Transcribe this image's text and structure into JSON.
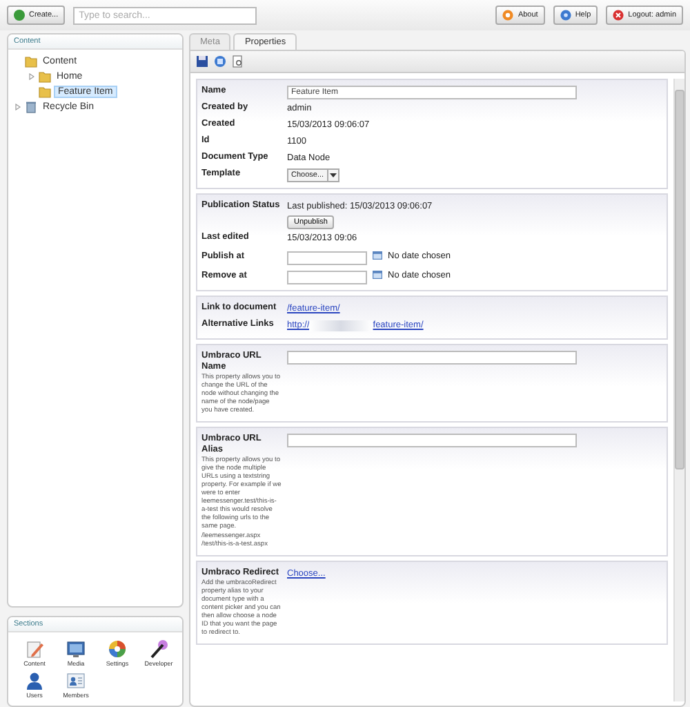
{
  "topbar": {
    "create_button": "Create...",
    "search": {
      "placeholder": "Type to search..."
    },
    "buttons": [
      {
        "kind": "about",
        "label": "About"
      },
      {
        "kind": "help",
        "label": "Help"
      },
      {
        "kind": "logout",
        "label": "Logout: admin"
      }
    ]
  },
  "tree": {
    "title": "Content",
    "items": [
      {
        "label": "Content",
        "kind": "folder",
        "selected": false,
        "expanded": true,
        "children": [
          {
            "label": "Home",
            "kind": "folder",
            "selected": false,
            "expanded": false
          },
          {
            "label": "Feature Item",
            "kind": "folder",
            "selected": true
          }
        ]
      },
      {
        "label": "Recycle Bin",
        "kind": "bin",
        "selected": false,
        "expanded": false
      }
    ]
  },
  "sections": {
    "title": "Sections",
    "items": [
      {
        "kind": "content",
        "label": "Content"
      },
      {
        "kind": "media",
        "label": "Media"
      },
      {
        "kind": "settings",
        "label": "Settings"
      },
      {
        "kind": "developer",
        "label": "Developer"
      },
      {
        "kind": "users",
        "label": "Users"
      },
      {
        "kind": "members",
        "label": "Members"
      }
    ]
  },
  "tabs": [
    {
      "label": "Meta",
      "selected": false
    },
    {
      "label": "Properties",
      "selected": true
    }
  ],
  "panels": [
    {
      "rows": [
        {
          "kind": "input",
          "label": "Name",
          "value": "Feature Item"
        },
        {
          "kind": "text",
          "label": "Created by",
          "value": "admin"
        },
        {
          "kind": "text",
          "label": "Created",
          "value": "15/03/2013 09:06:07"
        },
        {
          "kind": "text",
          "label": "Id",
          "value": "1100"
        },
        {
          "kind": "text",
          "label": "Document Type",
          "value": "Data Node"
        },
        {
          "kind": "select",
          "label": "Template",
          "value": "Choose..."
        }
      ]
    },
    {
      "rows": [
        {
          "kind": "status",
          "label": "Publication Status",
          "value": "Last published: 15/03/2013 09:06:07",
          "button": "Unpublish"
        },
        {
          "kind": "text",
          "label": "Last edited",
          "value": "15/03/2013 09:06"
        },
        {
          "kind": "date",
          "label": "Publish at",
          "note": "No date chosen"
        },
        {
          "kind": "date",
          "label": "Remove at",
          "note": "No date chosen"
        }
      ]
    },
    {
      "rows": [
        {
          "kind": "link",
          "label": "Link to document",
          "value": "/feature-item/"
        },
        {
          "kind": "redacted_link",
          "label": "Alternative Links",
          "prefix": "http://",
          "suffix": "feature-item/"
        }
      ]
    },
    {
      "rows": [
        {
          "kind": "input",
          "label": "Umbraco URL Name",
          "value": "",
          "description": [
            "This property allows you to change the URL of the node without changing the name of the node/page you have created."
          ]
        }
      ]
    },
    {
      "rows": [
        {
          "kind": "input",
          "label": "Umbraco URL Alias",
          "value": "",
          "description": [
            "This property allows you to give the node multiple URLs using a textstring property. For example if we were to enter leemessenger.test/this-is-a-test this would resolve the following urls to the same page.",
            "/leemessenger.aspx /test/this-is-a-test.aspx"
          ]
        }
      ]
    },
    {
      "rows": [
        {
          "kind": "link",
          "label": "Umbraco Redirect",
          "value": "Choose...",
          "description": [
            "Add the umbracoRedirect property alias to your document type with a content picker and you can then allow choose a node ID that you want the page to redirect to."
          ]
        }
      ]
    }
  ]
}
